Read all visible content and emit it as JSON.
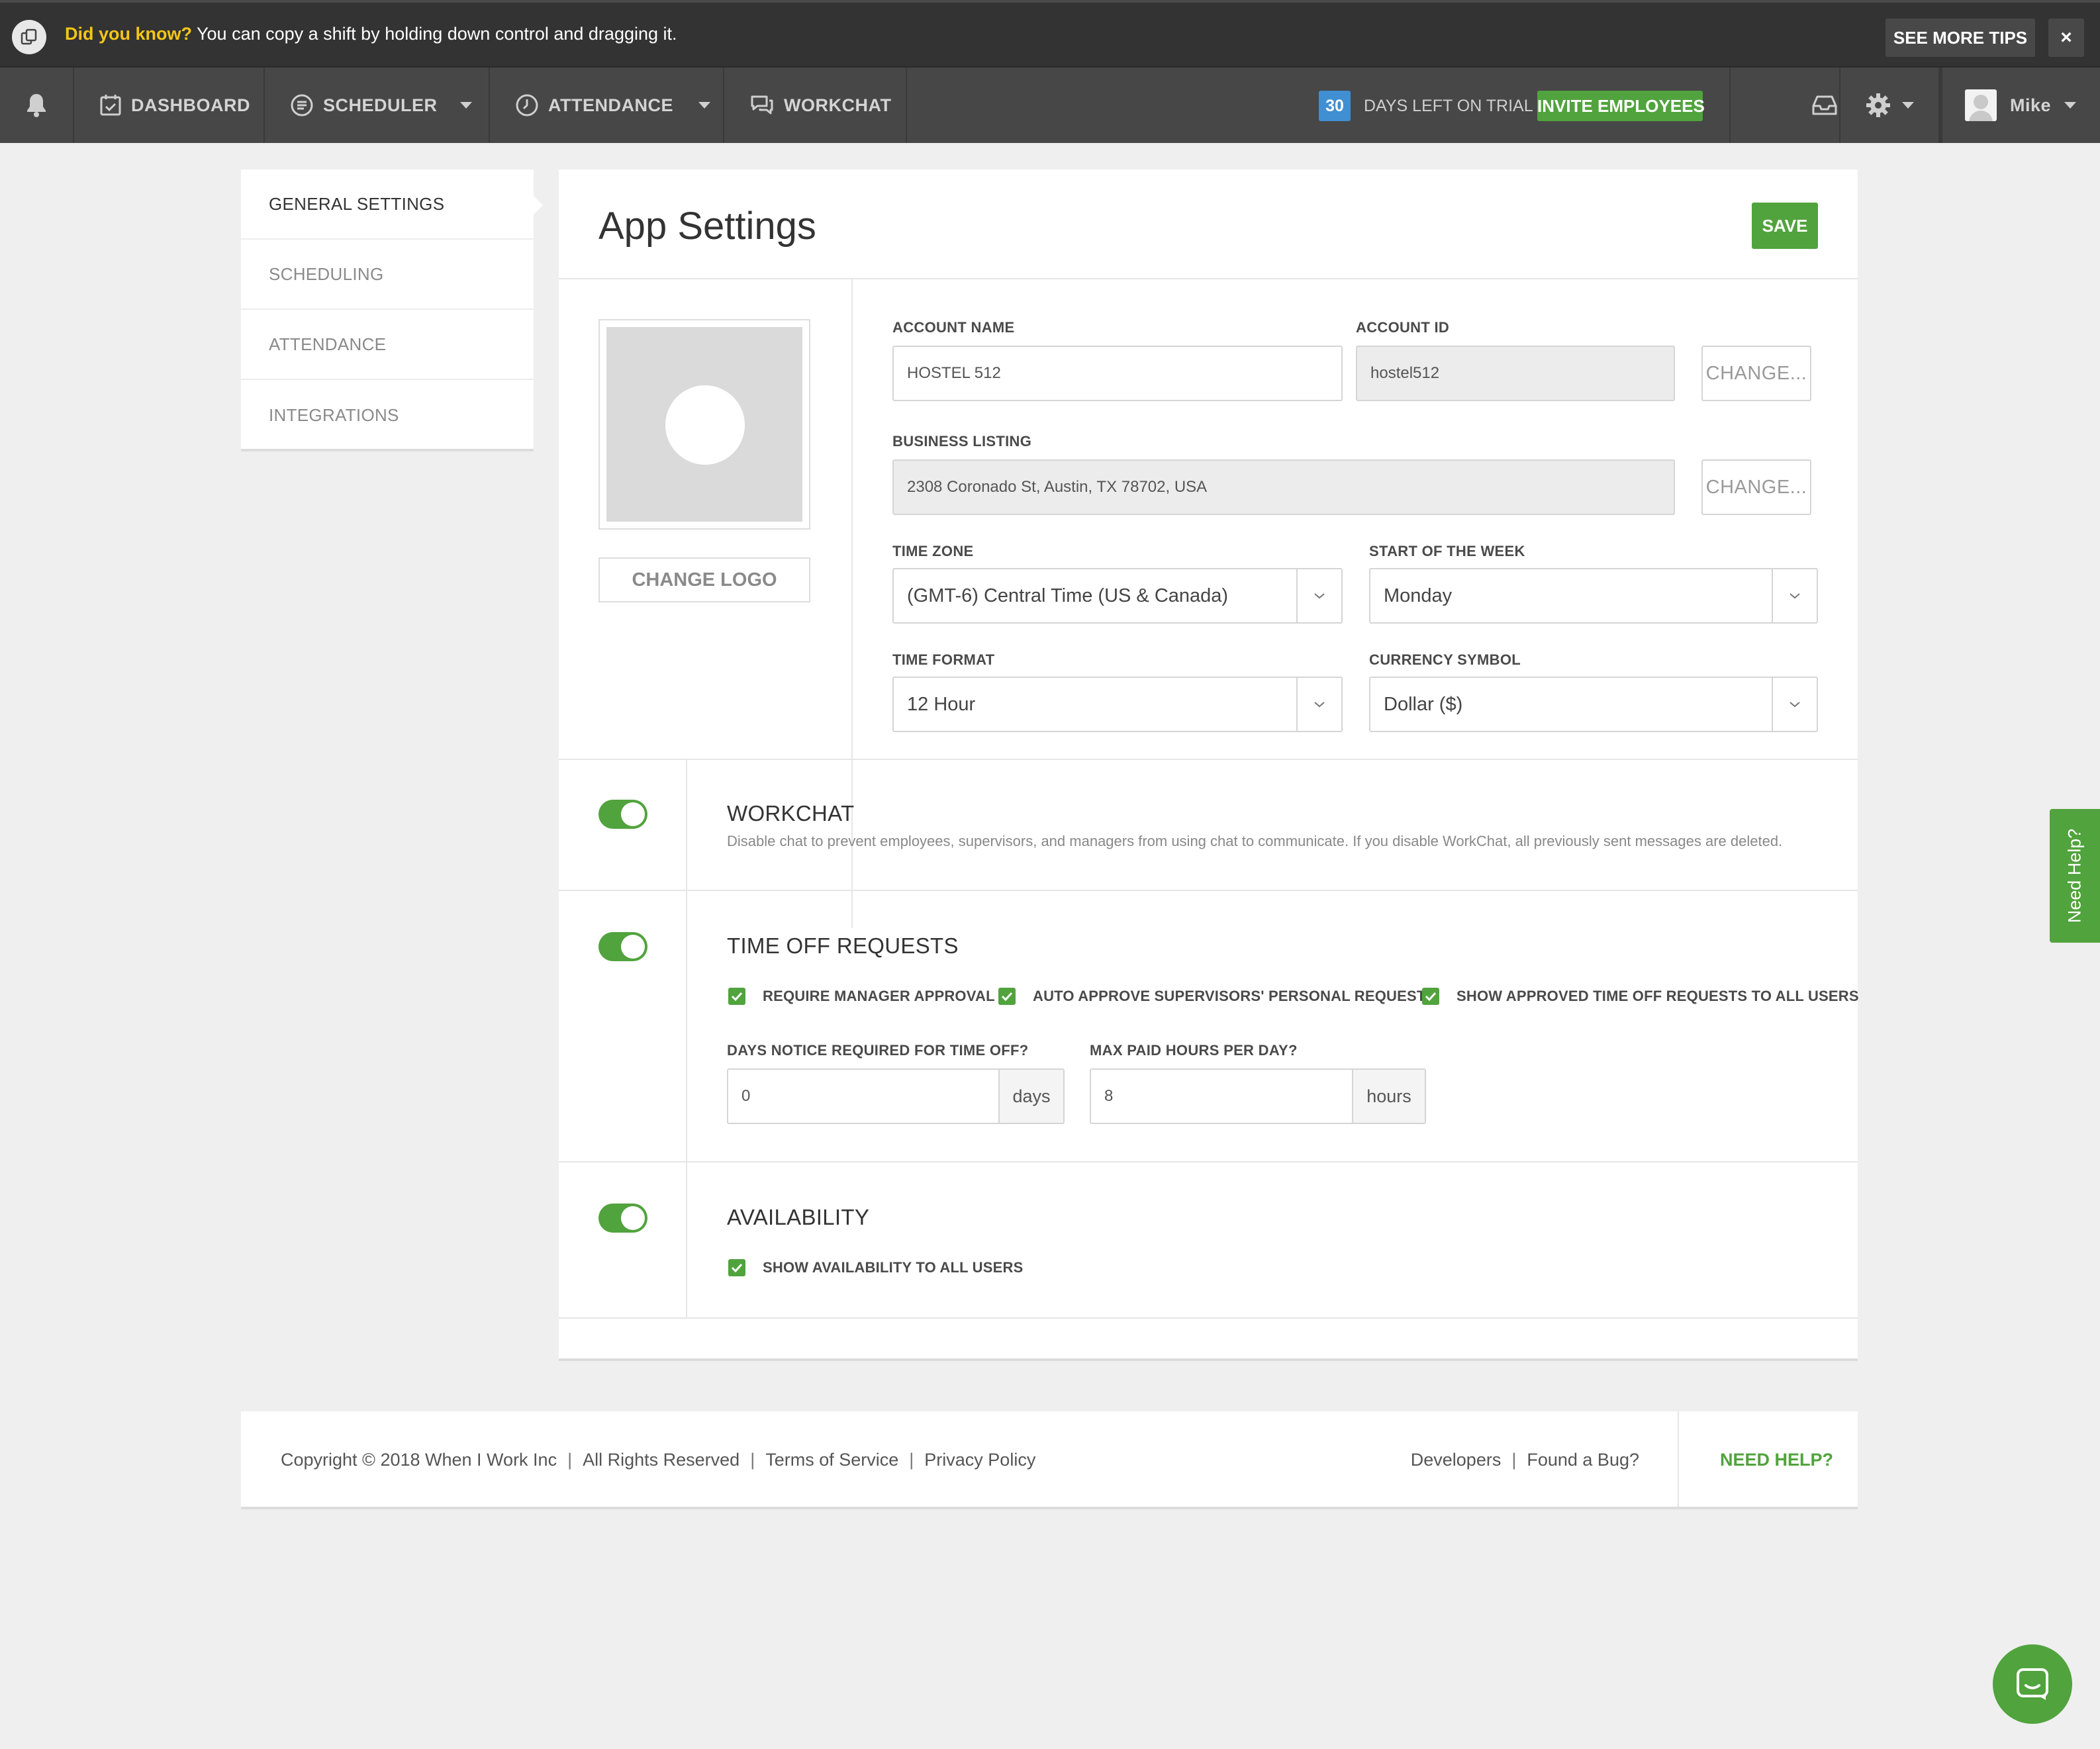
{
  "tipbar": {
    "highlight": "Did you know?",
    "message": " You can copy a shift by holding down control and dragging it.",
    "see_more": "SEE MORE TIPS",
    "close": "×"
  },
  "nav": {
    "dashboard": "DASHBOARD",
    "scheduler": "SCHEDULER",
    "attendance": "ATTENDANCE",
    "workchat": "WORKCHAT",
    "trial_days": "30",
    "trial_text": "DAYS LEFT ON TRIAL",
    "invite": "INVITE EMPLOYEES",
    "user": "Mike"
  },
  "sidebar": {
    "items": [
      {
        "label": "GENERAL SETTINGS"
      },
      {
        "label": "SCHEDULING"
      },
      {
        "label": "ATTENDANCE"
      },
      {
        "label": "INTEGRATIONS"
      }
    ]
  },
  "settings": {
    "title": "App Settings",
    "save": "SAVE",
    "change_logo": "CHANGE LOGO",
    "account_name": {
      "label": "ACCOUNT NAME",
      "value": "HOSTEL 512"
    },
    "account_id": {
      "label": "ACCOUNT ID",
      "value": "hostel512",
      "change": "CHANGE..."
    },
    "business_listing": {
      "label": "BUSINESS LISTING",
      "value": "2308 Coronado St, Austin, TX 78702, USA",
      "change": "CHANGE..."
    },
    "time_zone": {
      "label": "TIME ZONE",
      "value": "(GMT-6) Central Time (US & Canada)"
    },
    "start_week": {
      "label": "START OF THE WEEK",
      "value": "Monday"
    },
    "time_format": {
      "label": "TIME FORMAT",
      "value": "12 Hour"
    },
    "currency": {
      "label": "CURRENCY SYMBOL",
      "value": "Dollar ($)"
    }
  },
  "workchat": {
    "title": "WORKCHAT",
    "enabled": true,
    "description": "Disable chat to prevent employees, supervisors, and managers from using chat to communicate. If you disable WorkChat, all previously sent messages are deleted."
  },
  "time_off": {
    "title": "TIME OFF REQUESTS",
    "enabled": true,
    "options": [
      {
        "label": "REQUIRE MANAGER APPROVAL",
        "checked": true
      },
      {
        "label": "AUTO APPROVE SUPERVISORS' PERSONAL REQUESTS",
        "checked": true
      },
      {
        "label": "SHOW APPROVED TIME OFF REQUESTS TO ALL USERS",
        "checked": true
      }
    ],
    "days_notice": {
      "label": "DAYS NOTICE REQUIRED FOR TIME OFF?",
      "value": "0",
      "unit": "days"
    },
    "max_paid": {
      "label": "MAX PAID HOURS PER DAY?",
      "value": "8",
      "unit": "hours"
    }
  },
  "availability": {
    "title": "AVAILABILITY",
    "enabled": true,
    "options": [
      {
        "label": "SHOW AVAILABILITY TO ALL USERS",
        "checked": true
      }
    ]
  },
  "footer": {
    "copyright": "Copyright © 2018 When I Work Inc",
    "rights": "All Rights Reserved",
    "terms": "Terms of Service",
    "privacy": "Privacy Policy",
    "developers": "Developers",
    "bug": "Found a Bug?",
    "help": "NEED HELP?",
    "sep": "|"
  },
  "floating": {
    "need_help": "Need Help?"
  },
  "colors": {
    "accent": "#51a33d",
    "nav_bg": "#474747",
    "tip_bg": "#333333",
    "trial_badge": "#3f8fd2",
    "tip_highlight": "#f5c518"
  }
}
